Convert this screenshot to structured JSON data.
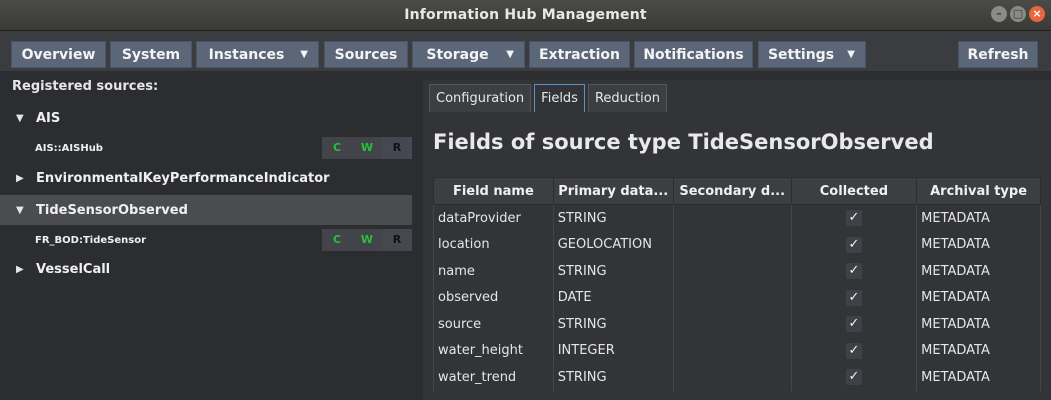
{
  "window": {
    "title": "Information Hub Management"
  },
  "menu": {
    "items": [
      {
        "label": "Overview",
        "dropdown": false
      },
      {
        "label": "System",
        "dropdown": false
      },
      {
        "label": "Instances",
        "dropdown": true
      },
      {
        "label": "Sources",
        "dropdown": false
      },
      {
        "label": "Storage",
        "dropdown": true
      },
      {
        "label": "Extraction",
        "dropdown": false
      },
      {
        "label": "Notifications",
        "dropdown": false
      },
      {
        "label": "Settings",
        "dropdown": true
      }
    ],
    "refresh_label": "Refresh"
  },
  "left": {
    "registered_label": "Registered sources:",
    "tree": [
      {
        "name": "AIS",
        "expanded": true,
        "arrow": "▼"
      },
      {
        "name": "AIS::AISHub",
        "child": true,
        "flags": [
          "C",
          "W",
          "R"
        ]
      },
      {
        "name": "EnvironmentalKeyPerformanceIndicator",
        "expanded": false,
        "arrow": "▶"
      },
      {
        "name": "TideSensorObserved",
        "expanded": true,
        "arrow": "▼",
        "selected": true
      },
      {
        "name": "FR_BOD:TideSensor",
        "child": true,
        "flags": [
          "C",
          "W",
          "R"
        ]
      },
      {
        "name": "VesselCall",
        "expanded": false,
        "arrow": "▶"
      }
    ]
  },
  "right": {
    "tabs": [
      "Configuration",
      "Fields",
      "Reduction"
    ],
    "active_tab": "Fields",
    "heading": "Fields of source type TideSensorObserved",
    "columns": [
      "Field name",
      "Primary data...",
      "Secondary d...",
      "Collected",
      "Archival type"
    ],
    "rows": [
      {
        "field": "dataProvider",
        "primary": "STRING",
        "secondary": "",
        "collected": "✓",
        "archival": "METADATA"
      },
      {
        "field": "location",
        "primary": "GEOLOCATION",
        "secondary": "",
        "collected": "✓",
        "archival": "METADATA"
      },
      {
        "field": "name",
        "primary": "STRING",
        "secondary": "",
        "collected": "✓",
        "archival": "METADATA"
      },
      {
        "field": "observed",
        "primary": "DATE",
        "secondary": "",
        "collected": "✓",
        "archival": "METADATA"
      },
      {
        "field": "source",
        "primary": "STRING",
        "secondary": "",
        "collected": "✓",
        "archival": "METADATA"
      },
      {
        "field": "water_height",
        "primary": "INTEGER",
        "secondary": "",
        "collected": "✓",
        "archival": "METADATA"
      },
      {
        "field": "water_trend",
        "primary": "STRING",
        "secondary": "",
        "collected": "✓",
        "archival": "METADATA"
      }
    ]
  }
}
